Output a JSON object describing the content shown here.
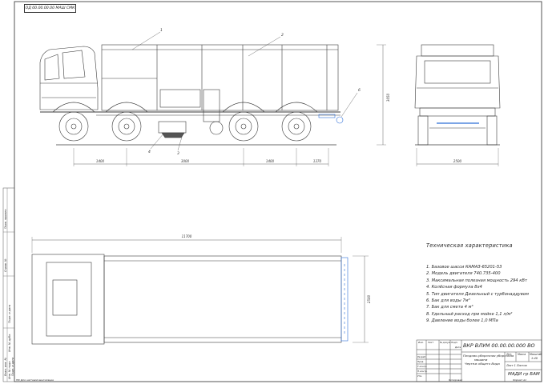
{
  "doc_code_stamp": "ОД 00.00.00.00 МАШ СМК",
  "dimensions": {
    "side_1": "1400",
    "side_2": "3000",
    "side_3": "1400",
    "side_4": "1370",
    "height": "3050",
    "front_width": "2500",
    "plan_length": "11700",
    "plan_width": "2500"
  },
  "callouts": [
    "1",
    "2",
    "3",
    "4",
    "5",
    "6"
  ],
  "tech_spec": {
    "title": "Техническая характеристика",
    "items": [
      "1. Базовое шасси КАМАЗ-65201-53",
      "2. Модель двигателя 740.735-400",
      "3. Максимальная полезная мощность 294 кВт",
      "4. Колёсная формула 8х4",
      "5. Тип двигателя Дизельный с турбонаддувом",
      "6. Бак для воды 7м³",
      "7. Бак для смета 4 м³",
      "8. Удельный расход при мойке 1,1 л/м²",
      "9. Давление воды более 1,0 МПа"
    ]
  },
  "title_block": {
    "doc_number": "ВКР ВЛУМ 00.00.00.000 ВО",
    "name_line1": "Плодово-уборочная уборочная",
    "name_line2": "машина",
    "name_line3": "Чертеж общего Вида",
    "sheet_label": "Лит.",
    "mass_label": "Масса",
    "scale_label": "Масштаб",
    "scale_value": "1:40",
    "sheet_info": "Лист 1   Листов",
    "org": "МАДИ гр БАМ",
    "roles": [
      "Изм.",
      "Лист",
      "№ докум.",
      "Подп.",
      "Дата",
      "Разраб.",
      "Пров.",
      "Т.контр.",
      "Н.контр.",
      "Утв."
    ],
    "copy_label": "Копировал",
    "format_label": "Формат А1"
  },
  "side_notes": [
    "Перв. примен.",
    "Справ. №",
    "Подп. и дата",
    "Инв. № дубл.",
    "Взам. инв. №",
    "Подп. и дата",
    "Инв. № подл."
  ],
  "bottom_note": "ПФ Для чистовой вентиляции",
  "colors": {
    "line": "#3a3a3a",
    "accent": "#2f6fd8",
    "bg": "#ffffff"
  }
}
